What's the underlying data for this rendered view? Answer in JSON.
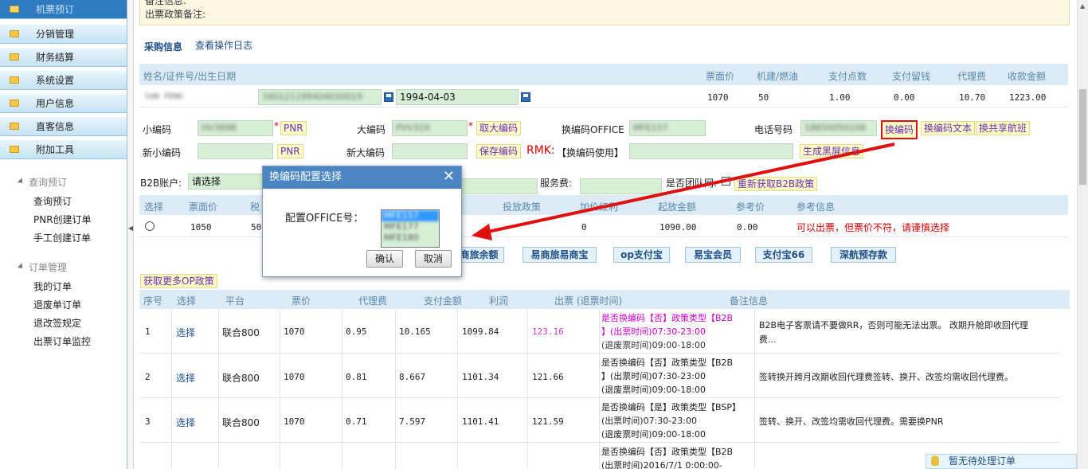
{
  "sidebar": {
    "menu": [
      {
        "label": "机票预订",
        "active": true
      },
      {
        "label": "分销管理"
      },
      {
        "label": "财务结算"
      },
      {
        "label": "系统设置"
      },
      {
        "label": "用户信息"
      },
      {
        "label": "直客信息"
      },
      {
        "label": "附加工具"
      }
    ],
    "booking_section": "查询预订",
    "booking_links": [
      "查询预订",
      "PNR创建订单",
      "手工创建订单"
    ],
    "order_section": "订单管理",
    "order_links": [
      "我的订单",
      "退废单订单",
      "退改签规定",
      "出票订单监控"
    ]
  },
  "notes": {
    "line1": "备注信息:",
    "line2": "出票政策备注:"
  },
  "tabs": [
    "采购信息",
    "查看操作日志"
  ],
  "passenger_table": {
    "headers": [
      "姓名/证件号/出生日期",
      "票面价",
      "机建/燃油",
      "支付点数",
      "支付留钱",
      "代理费",
      "收款金额"
    ],
    "row": {
      "name": "SAN PENG",
      "id_no": "340121199404030019",
      "birth": "1994-04-03",
      "price": "1070",
      "tax": "50",
      "points": "1.00",
      "retain": "0.00",
      "agent_fee": "10.70",
      "receivable": "1223.00"
    }
  },
  "codes": {
    "small_code_label": "小编码",
    "small_code_value": "HV3698",
    "pnr_button": "PNR",
    "big_code_label": "大编码",
    "big_code_value": "PVV32X",
    "fetch_big_button": "取大编码",
    "change_office_label": "换编码OFFICE",
    "change_office_value": "MFE157",
    "phone_label": "电话号码",
    "phone_value": "18650050108",
    "change_code_button": "换编码",
    "change_code_text_button": "换编码文本",
    "change_shared_button": "换共享航班",
    "new_small_label": "新小编码",
    "new_pnr_button": "PNR",
    "new_big_label": "新大编码",
    "save_code_button": "保存编码",
    "rmk_label": "RMK:",
    "rmk_text": "【换编码使用】",
    "gen_screen_button": "生成黑屏信息"
  },
  "b2b": {
    "account_label": "B2B账户:",
    "account_value": "请选择",
    "service_fee_label": "服务费:",
    "group_label": "是否团队网:",
    "refetch_button": "重新获取B2B政策",
    "headers": [
      "选择",
      "票面价",
      "税",
      "投放政策",
      "加价红利",
      "起放金额",
      "参考价",
      "参考信息"
    ],
    "row": {
      "price": "1050",
      "tax": "50",
      "bonus": "0",
      "amount": "1090.00",
      "ref_price": "0.00",
      "ref_info": "可以出票，但票价不符，请谨慎选择"
    }
  },
  "pay_buttons": [
    "易商旅余额",
    "易商旅易商宝",
    "op支付宝",
    "易宝会员",
    "支付宝66",
    "深航预存款"
  ],
  "op_button": "获取更多OP政策",
  "policy_table": {
    "headers": [
      "序号",
      "选择",
      "平台",
      "票价",
      "代理费",
      "支付金额",
      "利润",
      "出票 (退票时间)",
      "备注信息"
    ],
    "rows": [
      {
        "no": "1",
        "select": "选择",
        "platform": "联合800",
        "price": "1070",
        "fee": "0.95",
        "pay": "10.165",
        "amount": "1099.84",
        "profit": "123.16",
        "ticket1": "是否换编码【否】政策类型【B2B",
        "ticket2": "】(出票时间)07:30-23:00",
        "ticket3": "(退废票时间)09:00-18:00",
        "remark": "B2B电子客票请不要做RR，否则可能无法出票。 改期升舱即收回代理",
        "remark2": "费..."
      },
      {
        "no": "2",
        "select": "选择",
        "platform": "联合800",
        "price": "1070",
        "fee": "0.81",
        "pay": "8.667",
        "amount": "1101.34",
        "profit": "121.66",
        "ticket1": "是否换编码【否】政策类型【B2B",
        "ticket2": "】(出票时间)07:30-23:00",
        "ticket3": "(退废票时间)09:00-18:00",
        "remark": "签转换开跨月改期收回代理费签转、换开、改签均需收回代理费。",
        "remark2": ""
      },
      {
        "no": "3",
        "select": "选择",
        "platform": "联合800",
        "price": "1070",
        "fee": "0.71",
        "pay": "7.597",
        "amount": "1101.41",
        "profit": "121.59",
        "ticket1": "是否换编码【是】政策类型【BSP】",
        "ticket2": "(出票时间)07:30-23:00",
        "ticket3": "(退废票时间)09:00-18:00",
        "remark": "签转、换开、改签均需收回代理费。需要换PNR",
        "remark2": ""
      },
      {
        "no": "",
        "select": "",
        "platform": "",
        "price": "",
        "fee": "",
        "pay": "",
        "amount": "",
        "profit": "",
        "ticket1": "是否换编码【否】政策类型【B2B",
        "ticket2": "(出票时间)2016/7/1 0:00:00-",
        "ticket3": "",
        "remark": "",
        "remark2": ""
      }
    ]
  },
  "dialog": {
    "title": "换编码配置选择",
    "close": "✕",
    "label": "配置OFFICE号：",
    "options": [
      "MFE157",
      "MFE177",
      "MFE180"
    ],
    "ok": "确认",
    "cancel": "取消"
  },
  "notice": "暂无待处理订单"
}
